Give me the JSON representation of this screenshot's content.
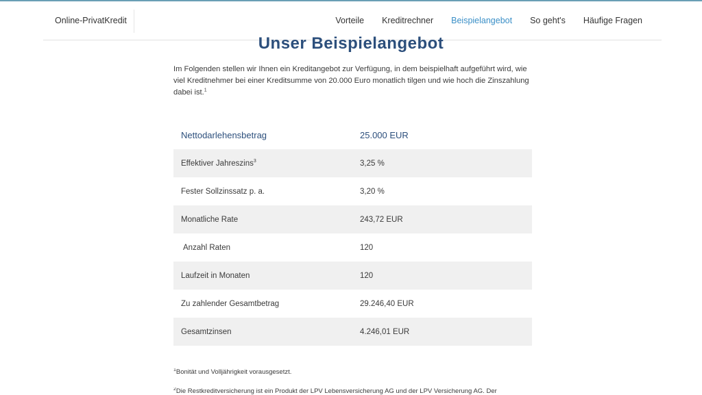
{
  "header": {
    "brand": "Online-PrivatKredit",
    "nav": [
      {
        "label": "Vorteile",
        "active": false
      },
      {
        "label": "Kreditrechner",
        "active": false
      },
      {
        "label": "Beispielangebot",
        "active": true
      },
      {
        "label": "So geht's",
        "active": false
      },
      {
        "label": "Häufige Fragen",
        "active": false
      }
    ]
  },
  "colors": {
    "accent": "#3a8fc7",
    "title": "#2c4f7c",
    "row_alt": "#f0f0f0"
  },
  "main": {
    "title": "Unser Beispielangebot",
    "intro": "Im Folgenden stellen wir Ihnen ein Kreditangebot zur Verfügung, in dem beispielhaft aufgeführt wird, wie viel Kreditnehmer bei einer Kreditsumme von 20.000 Euro monatlich tilgen und wie hoch die Zinszahlung dabei ist.",
    "intro_sup": "1",
    "table": [
      {
        "label": "Nettodarlehensbetrag",
        "sup": "",
        "value": "25.000 EUR"
      },
      {
        "label": "Effektiver Jahreszins",
        "sup": "3",
        "value": "3,25 %"
      },
      {
        "label": "Fester Sollzinssatz p. a.",
        "sup": "",
        "value": "3,20 %"
      },
      {
        "label": "Monatliche Rate",
        "sup": "",
        "value": "243,72 EUR"
      },
      {
        "label": " Anzahl Raten",
        "sup": "",
        "value": "120"
      },
      {
        "label": "Laufzeit in Monaten",
        "sup": "",
        "value": "120"
      },
      {
        "label": "Zu zahlender Gesamtbetrag",
        "sup": "",
        "value": "29.246,40 EUR"
      },
      {
        "label": "Gesamtzinsen",
        "sup": "",
        "value": "4.246,01 EUR"
      }
    ],
    "footnotes": [
      {
        "sup": "1",
        "text": "Bonität und Volljährigkeit vorausgesetzt."
      },
      {
        "sup": "2",
        "text": "Die Restkreditversicherung ist ein Produkt der LPV Lebensversicherung AG und der LPV Versicherung AG. Der"
      }
    ]
  }
}
